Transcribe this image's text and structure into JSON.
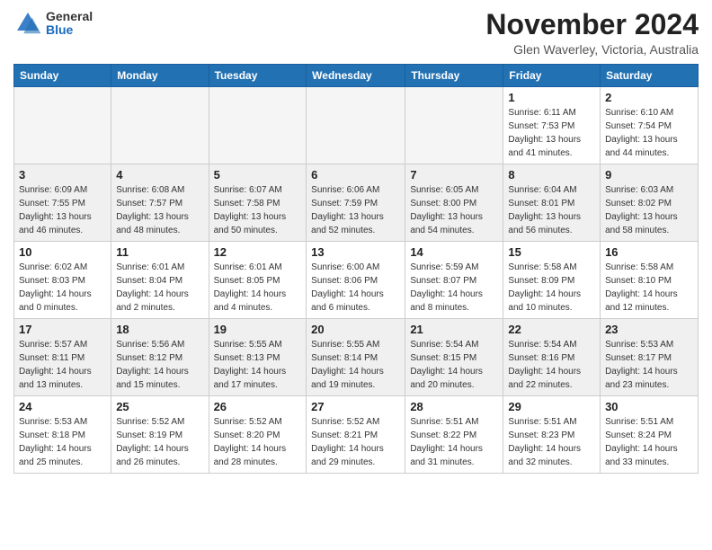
{
  "header": {
    "logo_general": "General",
    "logo_blue": "Blue",
    "month_title": "November 2024",
    "location": "Glen Waverley, Victoria, Australia"
  },
  "weekdays": [
    "Sunday",
    "Monday",
    "Tuesday",
    "Wednesday",
    "Thursday",
    "Friday",
    "Saturday"
  ],
  "weeks": [
    [
      {
        "day": "",
        "info": ""
      },
      {
        "day": "",
        "info": ""
      },
      {
        "day": "",
        "info": ""
      },
      {
        "day": "",
        "info": ""
      },
      {
        "day": "",
        "info": ""
      },
      {
        "day": "1",
        "info": "Sunrise: 6:11 AM\nSunset: 7:53 PM\nDaylight: 13 hours\nand 41 minutes."
      },
      {
        "day": "2",
        "info": "Sunrise: 6:10 AM\nSunset: 7:54 PM\nDaylight: 13 hours\nand 44 minutes."
      }
    ],
    [
      {
        "day": "3",
        "info": "Sunrise: 6:09 AM\nSunset: 7:55 PM\nDaylight: 13 hours\nand 46 minutes."
      },
      {
        "day": "4",
        "info": "Sunrise: 6:08 AM\nSunset: 7:57 PM\nDaylight: 13 hours\nand 48 minutes."
      },
      {
        "day": "5",
        "info": "Sunrise: 6:07 AM\nSunset: 7:58 PM\nDaylight: 13 hours\nand 50 minutes."
      },
      {
        "day": "6",
        "info": "Sunrise: 6:06 AM\nSunset: 7:59 PM\nDaylight: 13 hours\nand 52 minutes."
      },
      {
        "day": "7",
        "info": "Sunrise: 6:05 AM\nSunset: 8:00 PM\nDaylight: 13 hours\nand 54 minutes."
      },
      {
        "day": "8",
        "info": "Sunrise: 6:04 AM\nSunset: 8:01 PM\nDaylight: 13 hours\nand 56 minutes."
      },
      {
        "day": "9",
        "info": "Sunrise: 6:03 AM\nSunset: 8:02 PM\nDaylight: 13 hours\nand 58 minutes."
      }
    ],
    [
      {
        "day": "10",
        "info": "Sunrise: 6:02 AM\nSunset: 8:03 PM\nDaylight: 14 hours\nand 0 minutes."
      },
      {
        "day": "11",
        "info": "Sunrise: 6:01 AM\nSunset: 8:04 PM\nDaylight: 14 hours\nand 2 minutes."
      },
      {
        "day": "12",
        "info": "Sunrise: 6:01 AM\nSunset: 8:05 PM\nDaylight: 14 hours\nand 4 minutes."
      },
      {
        "day": "13",
        "info": "Sunrise: 6:00 AM\nSunset: 8:06 PM\nDaylight: 14 hours\nand 6 minutes."
      },
      {
        "day": "14",
        "info": "Sunrise: 5:59 AM\nSunset: 8:07 PM\nDaylight: 14 hours\nand 8 minutes."
      },
      {
        "day": "15",
        "info": "Sunrise: 5:58 AM\nSunset: 8:09 PM\nDaylight: 14 hours\nand 10 minutes."
      },
      {
        "day": "16",
        "info": "Sunrise: 5:58 AM\nSunset: 8:10 PM\nDaylight: 14 hours\nand 12 minutes."
      }
    ],
    [
      {
        "day": "17",
        "info": "Sunrise: 5:57 AM\nSunset: 8:11 PM\nDaylight: 14 hours\nand 13 minutes."
      },
      {
        "day": "18",
        "info": "Sunrise: 5:56 AM\nSunset: 8:12 PM\nDaylight: 14 hours\nand 15 minutes."
      },
      {
        "day": "19",
        "info": "Sunrise: 5:55 AM\nSunset: 8:13 PM\nDaylight: 14 hours\nand 17 minutes."
      },
      {
        "day": "20",
        "info": "Sunrise: 5:55 AM\nSunset: 8:14 PM\nDaylight: 14 hours\nand 19 minutes."
      },
      {
        "day": "21",
        "info": "Sunrise: 5:54 AM\nSunset: 8:15 PM\nDaylight: 14 hours\nand 20 minutes."
      },
      {
        "day": "22",
        "info": "Sunrise: 5:54 AM\nSunset: 8:16 PM\nDaylight: 14 hours\nand 22 minutes."
      },
      {
        "day": "23",
        "info": "Sunrise: 5:53 AM\nSunset: 8:17 PM\nDaylight: 14 hours\nand 23 minutes."
      }
    ],
    [
      {
        "day": "24",
        "info": "Sunrise: 5:53 AM\nSunset: 8:18 PM\nDaylight: 14 hours\nand 25 minutes."
      },
      {
        "day": "25",
        "info": "Sunrise: 5:52 AM\nSunset: 8:19 PM\nDaylight: 14 hours\nand 26 minutes."
      },
      {
        "day": "26",
        "info": "Sunrise: 5:52 AM\nSunset: 8:20 PM\nDaylight: 14 hours\nand 28 minutes."
      },
      {
        "day": "27",
        "info": "Sunrise: 5:52 AM\nSunset: 8:21 PM\nDaylight: 14 hours\nand 29 minutes."
      },
      {
        "day": "28",
        "info": "Sunrise: 5:51 AM\nSunset: 8:22 PM\nDaylight: 14 hours\nand 31 minutes."
      },
      {
        "day": "29",
        "info": "Sunrise: 5:51 AM\nSunset: 8:23 PM\nDaylight: 14 hours\nand 32 minutes."
      },
      {
        "day": "30",
        "info": "Sunrise: 5:51 AM\nSunset: 8:24 PM\nDaylight: 14 hours\nand 33 minutes."
      }
    ]
  ]
}
